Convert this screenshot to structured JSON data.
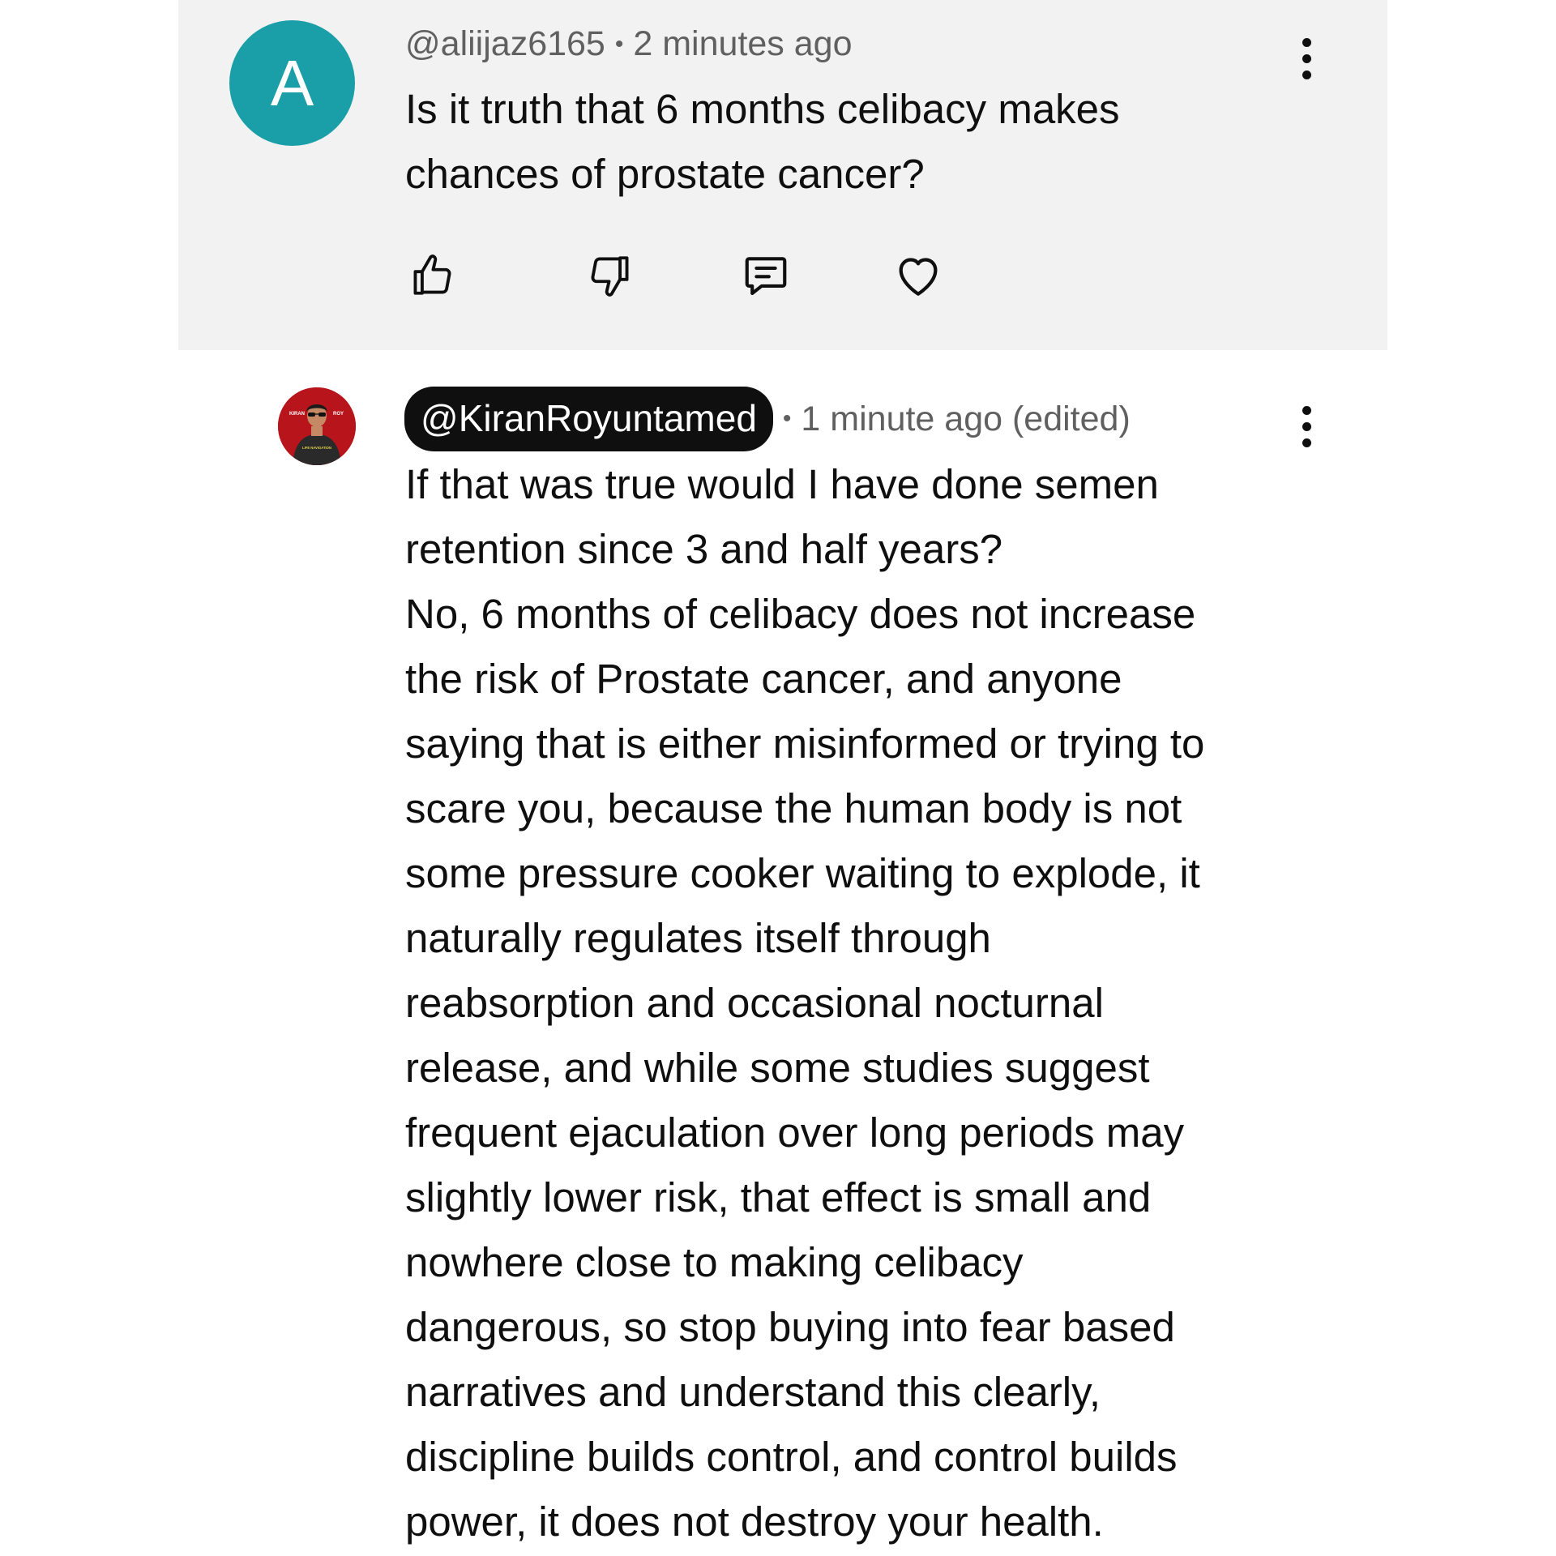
{
  "comment": {
    "avatar_letter": "A",
    "author": "@aliijaz6165",
    "separator": "•",
    "time": "2 minutes ago",
    "text": "Is it truth that 6 months celibacy makes\nchances of prostate cancer?",
    "actions": [
      "like-icon",
      "dislike-icon",
      "reply-icon",
      "heart-icon"
    ]
  },
  "reply": {
    "author": "@KiranRoyuntamed",
    "separator": "•",
    "time": "1 minute ago (edited)",
    "text": "If that was true would I have done semen\nretention since 3 and half years?\nNo, 6 months of celibacy does not increase\nthe risk of Prostate cancer, and anyone\nsaying that is either misinformed or trying to\nscare you, because the human body is not\nsome pressure cooker waiting to explode, it\nnaturally regulates itself through\nreabsorption and occasional nocturnal\nrelease, and while some studies suggest\nfrequent ejaculation over long periods may\nslightly lower risk, that effect is small and\nnowhere close to making celibacy\ndangerous, so stop buying into fear based\nnarratives and understand this clearly,\ndiscipline builds control, and control builds\npower, it does not destroy your health.",
    "avatar_logo_left": "KIRAN",
    "avatar_logo_right": "ROY",
    "avatar_shirt_text": "LIFE NAVIGATION"
  },
  "colors": {
    "highlight_bg": "#f2f2f2",
    "avatar_teal": "#1a9ea8",
    "meta_gray": "#606060",
    "handle_pill": "#0f0f0f",
    "avatar_red": "#b8141c"
  }
}
